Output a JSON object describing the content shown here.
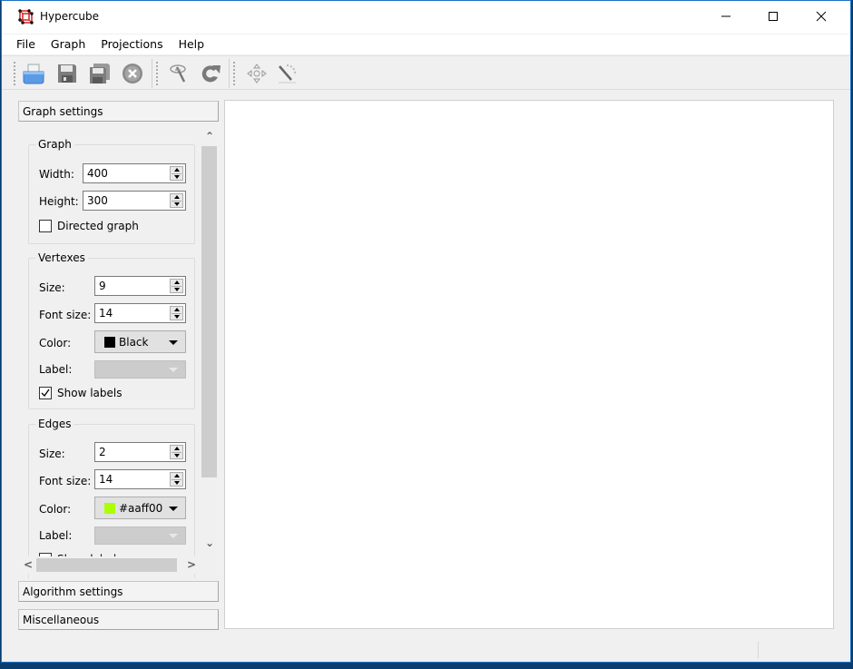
{
  "window": {
    "title": "Hypercube",
    "controls": {
      "minimize": "—",
      "maximize": "☐",
      "close": "✕"
    }
  },
  "menubar": {
    "items": [
      {
        "label": "File"
      },
      {
        "label": "Graph"
      },
      {
        "label": "Projections"
      },
      {
        "label": "Help"
      }
    ]
  },
  "toolbar": {
    "buttons": [
      {
        "icon": "open-icon"
      },
      {
        "icon": "save-icon"
      },
      {
        "icon": "save-as-icon"
      },
      {
        "icon": "close-file-icon"
      },
      {
        "icon": "transform-icon"
      },
      {
        "icon": "reload-icon"
      },
      {
        "icon": "move-icon"
      },
      {
        "icon": "draw-edge-icon"
      }
    ]
  },
  "sidebar": {
    "sections": [
      {
        "label": "Graph settings"
      },
      {
        "label": "Algorithm settings"
      },
      {
        "label": "Miscellaneous"
      }
    ],
    "graph": {
      "title": "Graph",
      "width_label": "Width:",
      "width_value": "400",
      "height_label": "Height:",
      "height_value": "300",
      "directed_label": "Directed graph",
      "directed_checked": false
    },
    "vertexes": {
      "title": "Vertexes",
      "size_label": "Size:",
      "size_value": "9",
      "font_size_label": "Font size:",
      "font_size_value": "14",
      "color_label": "Color:",
      "color_value": "Black",
      "color_swatch": "#000000",
      "label_label": "Label:",
      "label_value": "",
      "show_labels_label": "Show labels",
      "show_labels_checked": true
    },
    "edges": {
      "title": "Edges",
      "size_label": "Size:",
      "size_value": "2",
      "font_size_label": "Font size:",
      "font_size_value": "14",
      "color_label": "Color:",
      "color_value": "#aaff00",
      "color_swatch": "#aaff00",
      "label_label": "Label:",
      "label_value": "",
      "show_labels_label": "Show labels",
      "show_labels_checked": false
    },
    "scroll": {
      "up": "⌃",
      "down": "⌄",
      "left": "<",
      "right": ">"
    }
  },
  "status": {
    "text": ""
  }
}
